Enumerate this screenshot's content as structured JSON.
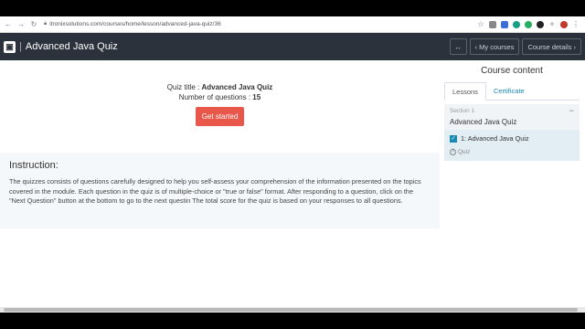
{
  "browser": {
    "url": "itronixsolutions.com/courses/home/lesson/advanced-java-quiz/36",
    "nav_back": "←",
    "nav_forward": "→",
    "nav_reload": "↻"
  },
  "header": {
    "title": "Advanced Java Quiz",
    "separator": "|",
    "expand_icon": "↔",
    "my_courses": "My courses",
    "course_details": "Course details"
  },
  "quiz": {
    "title_label": "Quiz title : ",
    "title_value": "Advanced Java Quiz",
    "questions_label": "Number of questions : ",
    "questions_value": "15",
    "start_button": "Get started"
  },
  "instruction": {
    "heading": "Instruction:",
    "text": "The quizzes consists of questions carefully designed to help you self-assess your comprehension of the information presented on the topics covered in the module. Each question in the quiz is of multiple-choice or \"true or false\" format. After responding to a question, click on the \"Next Question\" button at the bottom to go to the next questin The total score for the quiz is based on your responses to all questions."
  },
  "sidebar": {
    "title": "Course content",
    "tabs": [
      {
        "label": "Lessons"
      },
      {
        "label": "Certificate"
      }
    ],
    "section_label": "Section 1",
    "section_name": "Advanced Java Quiz",
    "collapse": "−",
    "lesson_name": "1: Advanced Java Quiz",
    "lesson_type": "Quiz"
  },
  "colors": {
    "header_bg": "#2b323b",
    "start_button": "#e8574a",
    "accent": "#1a8ab0"
  }
}
